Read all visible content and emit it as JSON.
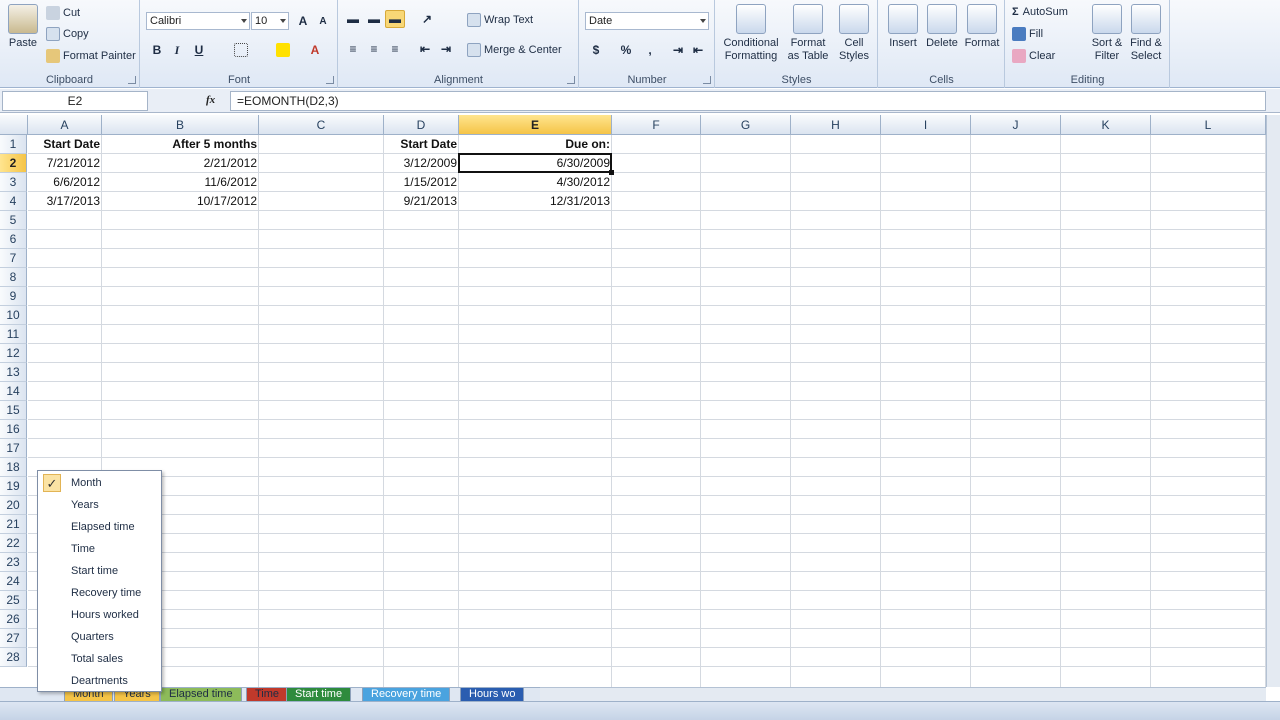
{
  "ribbon": {
    "clipboard": {
      "group_label": "Clipboard",
      "paste": "Paste",
      "cut": "Cut",
      "copy": "Copy",
      "format_painter": "Format Painter"
    },
    "font": {
      "group_label": "Font",
      "font_name": "Calibri",
      "font_size": "10",
      "bold": "B",
      "italic": "I",
      "underline": "U"
    },
    "alignment": {
      "group_label": "Alignment",
      "wrap_text": "Wrap Text",
      "merge_center": "Merge & Center"
    },
    "number": {
      "group_label": "Number",
      "format": "Date",
      "currency": "$",
      "percent": "%",
      "comma": ","
    },
    "styles": {
      "group_label": "Styles",
      "conditional_formatting": "Conditional Formatting",
      "format_as_table": "Format as Table",
      "cell_styles": "Cell Styles"
    },
    "cells": {
      "group_label": "Cells",
      "insert": "Insert",
      "delete": "Delete",
      "format": "Format"
    },
    "editing": {
      "group_label": "Editing",
      "autosum": "AutoSum",
      "fill": "Fill",
      "clear": "Clear",
      "sort_filter": "Sort & Filter",
      "find_select": "Find & Select"
    }
  },
  "formula_bar": {
    "name_box": "E2",
    "formula": "=EOMONTH(D2,3)"
  },
  "columns": [
    "A",
    "B",
    "C",
    "D",
    "E",
    "F",
    "G",
    "H",
    "I",
    "J",
    "K",
    "L"
  ],
  "rows": [
    "1",
    "2",
    "3",
    "4",
    "5",
    "6",
    "7",
    "8",
    "9",
    "10",
    "11",
    "12",
    "13",
    "14",
    "15",
    "16",
    "17",
    "18",
    "19",
    "20",
    "21",
    "22",
    "23",
    "24",
    "25",
    "26",
    "27",
    "28"
  ],
  "cells": {
    "A1": "Start Date",
    "B1": "After 5 months",
    "D1": "Start Date",
    "E1": "Due on:",
    "A2": "7/21/2012",
    "B2": "2/21/2012",
    "D2": "3/12/2009",
    "E2": "6/30/2009",
    "A3": "6/6/2012",
    "B3": "11/6/2012",
    "D3": "1/15/2012",
    "E3": "4/30/2012",
    "A4": "3/17/2013",
    "B4": "10/17/2012",
    "D4": "9/21/2013",
    "E4": "12/31/2013"
  },
  "sheet_menu": {
    "items": [
      {
        "label": "Month",
        "checked": true
      },
      {
        "label": "Years"
      },
      {
        "label": "Elapsed time"
      },
      {
        "label": "Time"
      },
      {
        "label": "Start time"
      },
      {
        "label": "Recovery time"
      },
      {
        "label": "Hours worked"
      },
      {
        "label": "Quarters"
      },
      {
        "label": "Total sales"
      },
      {
        "label": "Deartments"
      }
    ]
  },
  "sheet_tabs": [
    {
      "label": "Month",
      "color": "#f5c447"
    },
    {
      "label": "Years",
      "color": "#f5c447"
    },
    {
      "label": "Elapsed time",
      "color": "#8dbb5a"
    },
    {
      "label": "Time",
      "color": "#c0392b"
    },
    {
      "label": "Start time",
      "color": "#2e8b3d"
    },
    {
      "label": "Recovery time",
      "color": "#4aa3df"
    },
    {
      "label": "Hours wo",
      "color": "#2a5db0"
    }
  ],
  "colors": {
    "accent": "#f5c447",
    "header_bg": "#dbe4f0",
    "grid_line": "#d4d9e0"
  }
}
